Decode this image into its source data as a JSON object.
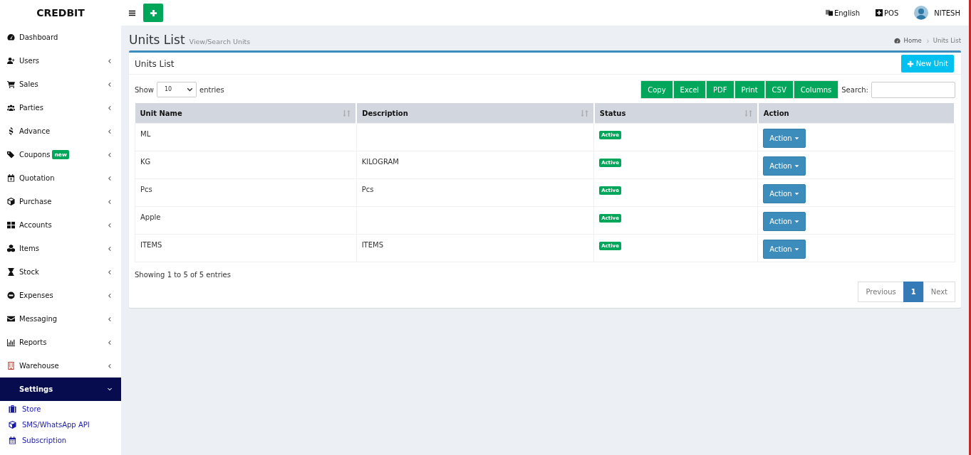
{
  "brand": "CREDBIT",
  "topbar": {
    "language": "English",
    "pos": "POS",
    "user": "NITESH"
  },
  "sidebar": {
    "items": [
      {
        "label": "Dashboard",
        "caret": false,
        "expanded": false
      },
      {
        "label": "Users",
        "caret": true,
        "expanded": false
      },
      {
        "label": "Sales",
        "caret": true,
        "expanded": false
      },
      {
        "label": "Parties",
        "caret": true,
        "expanded": false
      },
      {
        "label": "Advance",
        "caret": true,
        "expanded": false
      },
      {
        "label": "Coupons",
        "badge": "new",
        "caret": true,
        "expanded": false
      },
      {
        "label": "Quotation",
        "caret": true,
        "expanded": false
      },
      {
        "label": "Purchase",
        "caret": true,
        "expanded": false
      },
      {
        "label": "Accounts",
        "caret": true,
        "expanded": false
      },
      {
        "label": "Items",
        "caret": true,
        "expanded": false
      },
      {
        "label": "Stock",
        "caret": true,
        "expanded": false
      },
      {
        "label": "Expenses",
        "caret": true,
        "expanded": false
      },
      {
        "label": "Messaging",
        "caret": true,
        "expanded": false
      },
      {
        "label": "Reports",
        "caret": true,
        "expanded": false
      },
      {
        "label": "Warehouse",
        "caret": true,
        "expanded": false
      },
      {
        "label": "Settings",
        "caret": true,
        "expanded": true,
        "children": [
          {
            "label": "Store"
          },
          {
            "label": "SMS/WhatsApp API"
          },
          {
            "label": "Subscription"
          }
        ]
      }
    ]
  },
  "page": {
    "title": "Units List",
    "subtitle": "View/Search Units",
    "breadcrumb": [
      "Home",
      "Units List"
    ]
  },
  "box": {
    "title": "Units List",
    "new_button": "New Unit",
    "length": {
      "before": "Show",
      "value": "10",
      "after": "entries"
    },
    "export_buttons": [
      "Copy",
      "Excel",
      "PDF",
      "Print",
      "CSV",
      "Columns"
    ],
    "search_label": "Search:",
    "table": {
      "columns": [
        {
          "label": "Unit Name",
          "sortable": true
        },
        {
          "label": "Description",
          "sortable": true
        },
        {
          "label": "Status",
          "sortable": true
        },
        {
          "label": "Action",
          "sortable": false
        }
      ],
      "rows": [
        {
          "unit_name": "ML",
          "description": "",
          "status": "Active",
          "action": "Action"
        },
        {
          "unit_name": "KG",
          "description": "KILOGRAM",
          "status": "Active",
          "action": "Action"
        },
        {
          "unit_name": "Pcs",
          "description": "Pcs",
          "status": "Active",
          "action": "Action"
        },
        {
          "unit_name": "Apple",
          "description": "",
          "status": "Active",
          "action": "Action"
        },
        {
          "unit_name": "ITEMS",
          "description": "ITEMS",
          "status": "Active",
          "action": "Action"
        }
      ]
    },
    "info": "Showing 1 to 5 of 5 entries",
    "pagination": [
      {
        "label": "Previous",
        "selected": false
      },
      {
        "label": "1",
        "selected": true
      },
      {
        "label": "Next",
        "selected": false
      }
    ]
  }
}
